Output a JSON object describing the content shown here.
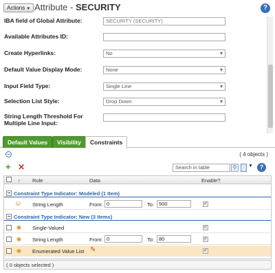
{
  "header": {
    "actions_label": "Actions",
    "title_prefix": "Attribute - ",
    "title_name": "SECURITY",
    "help_symbol": "?"
  },
  "form": {
    "iba_field_label": "IBA field of Global Attribute:",
    "iba_field_value": "SECURITY (SECURITY)",
    "available_attrs_label": "Available Attributes ID:",
    "available_attrs_value": "",
    "create_hyperlinks_label": "Create Hyperlinks:",
    "create_hyperlinks_value": "No",
    "default_display_label": "Default Value Display Mode:",
    "default_display_value": "None",
    "input_field_type_label": "Input Field Type:",
    "input_field_type_value": "Single Line",
    "selection_list_style_label": "Selection List Style:",
    "selection_list_style_value": "Drop Down",
    "string_threshold_label": "String Length Threshold For Multiple Line Input:",
    "string_threshold_value": ""
  },
  "tabs": [
    {
      "label": "Default Values",
      "active": false
    },
    {
      "label": "Visibility",
      "active": false
    },
    {
      "label": "Constraints",
      "active": true
    }
  ],
  "constraints": {
    "object_count": "( 4 objects )",
    "search_placeholder": "Search in table",
    "columns": {
      "sort_symbol": "↑",
      "rule": "Rule",
      "data": "Data",
      "enable": "Enable?"
    },
    "groups": [
      {
        "label": "Constraint Type Indicator: Modeled (1 Item)",
        "rows": [
          {
            "rule": "String Length",
            "from_label": "From:",
            "from": "0",
            "to_label": "To:",
            "to": "500",
            "enabled": true
          }
        ]
      },
      {
        "label": "Constraint Type Indicator: New (3 Items)",
        "rows": [
          {
            "rule": "Single-Valued",
            "enabled": true
          },
          {
            "rule": "String Length",
            "from_label": "From:",
            "from": "0",
            "to_label": "To:",
            "to": "80",
            "enabled": true
          },
          {
            "rule": "Enumerated Value List",
            "enabled": true,
            "highlighted": true
          }
        ]
      }
    ],
    "footer": "( 0 objects selected )"
  },
  "colors": {
    "tab_green": "#4e9a2f",
    "group_blue": "#2f5fa8",
    "highlight_row": "#fbe6c3",
    "help_blue": "#3a6fb7"
  },
  "icons": {
    "add": "plus-icon",
    "delete": "delete-x-icon",
    "search": "search-icon",
    "help": "help-icon",
    "edit": "pencil-icon",
    "lock": "lock-icon",
    "constraint": "constraint-icon"
  }
}
